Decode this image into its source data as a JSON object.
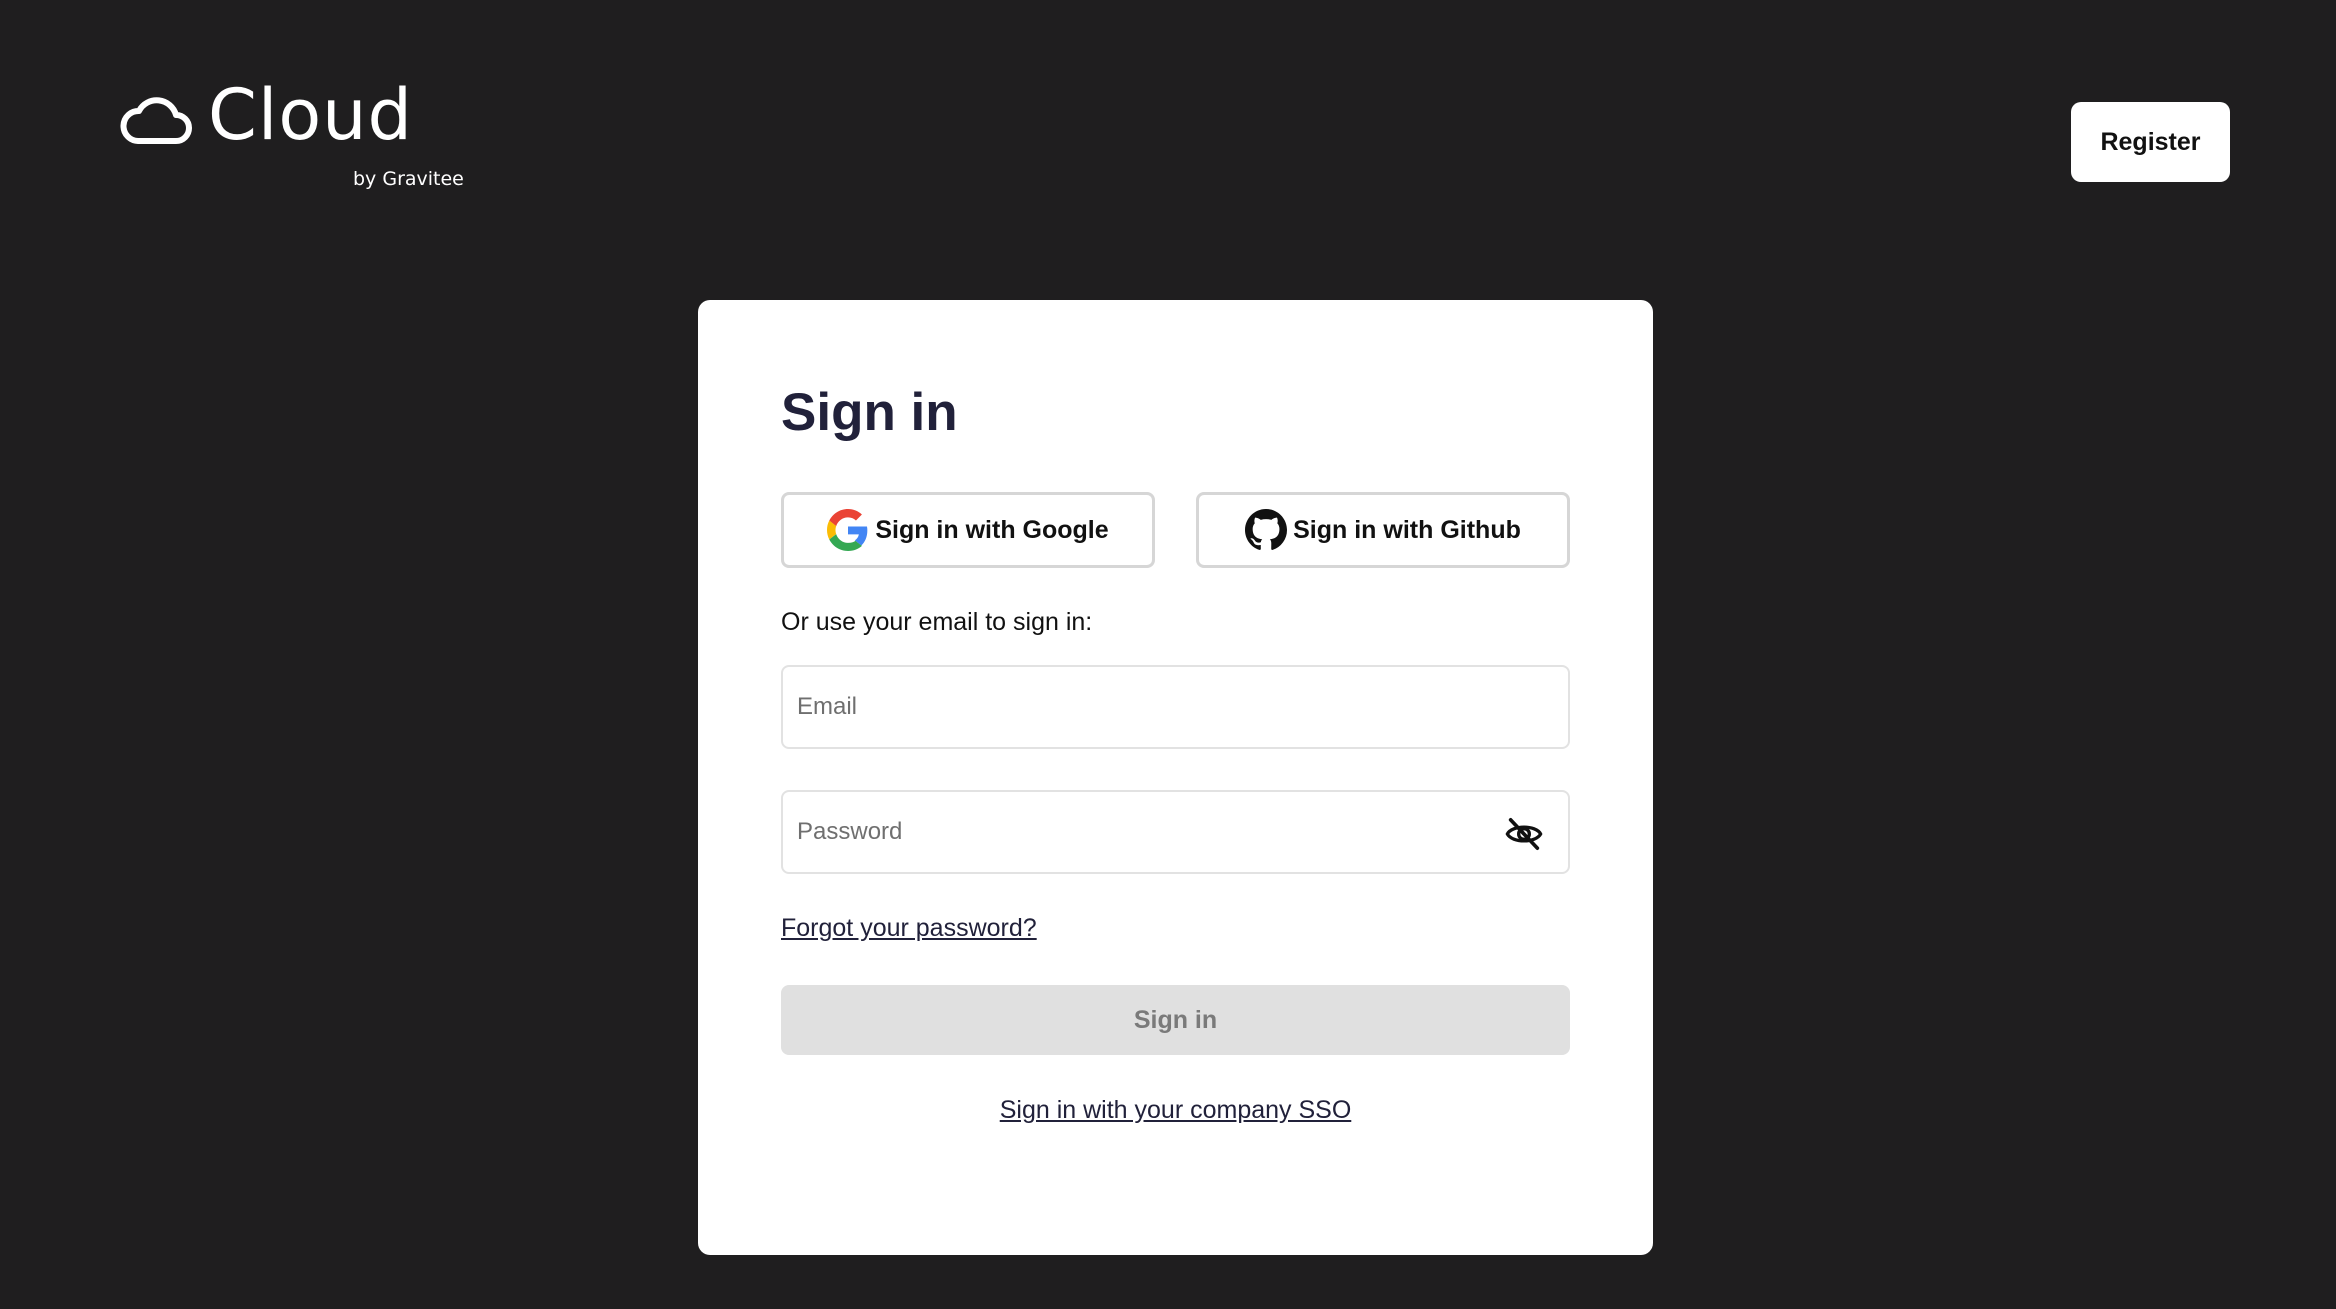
{
  "header": {
    "logo_text": "Cloud",
    "logo_sub": "by Gravitee",
    "logo_icon": "cloud-icon",
    "register_label": "Register"
  },
  "card": {
    "title": "Sign in",
    "google_label": "Sign in with Google",
    "github_label": "Sign in with Github",
    "or_text": "Or use your email to sign in:",
    "email_placeholder": "Email",
    "email_value": "",
    "password_placeholder": "Password",
    "password_value": "",
    "password_toggle_icon": "eye-off-icon",
    "forgot_label": "Forgot your password?",
    "submit_label": "Sign in",
    "sso_label": "Sign in with your company SSO"
  },
  "colors": {
    "background": "#1f1e1f",
    "card": "#ffffff",
    "title": "#21213a",
    "disabled_button": "#e0e0e0",
    "disabled_text": "#7a7a7a"
  }
}
